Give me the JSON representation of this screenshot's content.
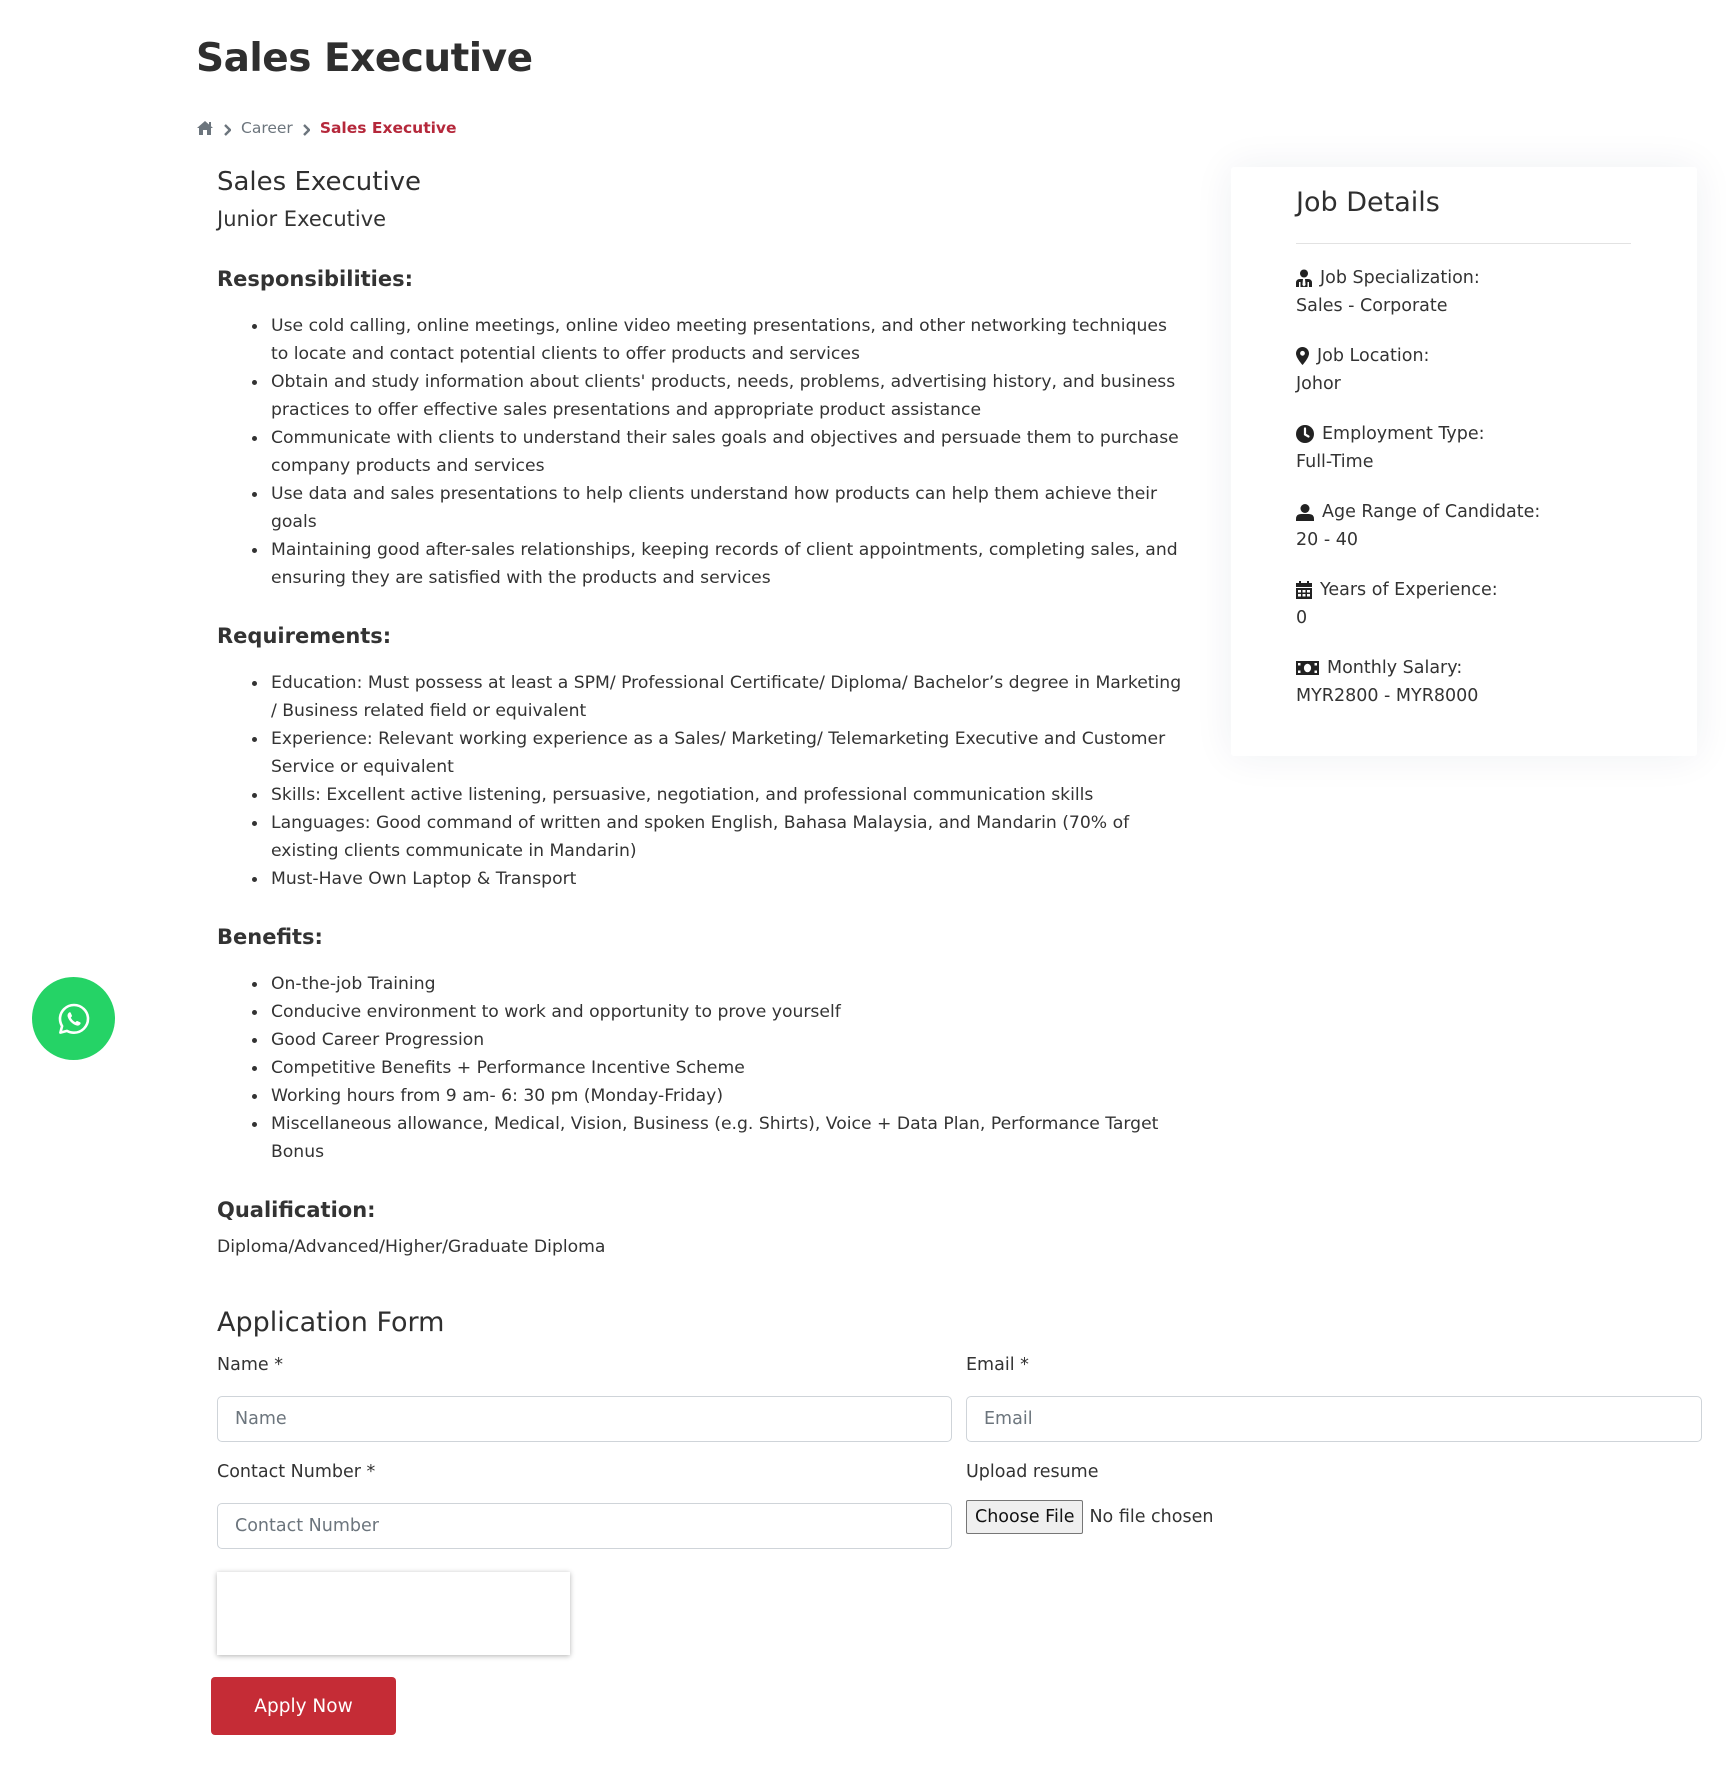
{
  "page": {
    "title": "Sales Executive"
  },
  "breadcrumb": {
    "home_icon": "home-icon",
    "separator_icon": "chevron-right-icon",
    "items": [
      "Career",
      "Sales Executive"
    ]
  },
  "job": {
    "title": "Sales Executive",
    "level": "Junior Executive",
    "responsibilities": {
      "heading": "Responsibilities:",
      "items": [
        "Use cold calling, online meetings, online video meeting presentations, and other networking techniques to locate and contact potential clients to offer products and services",
        "Obtain and study information about clients' products, needs, problems, advertising history, and business practices to offer effective sales presentations and appropriate product assistance",
        "Communicate with clients to understand their sales goals and objectives and persuade them to purchase company products and services",
        "Use data and sales presentations to help clients understand how products can help them achieve their goals",
        "Maintaining good after-sales relationships, keeping records of client appointments, completing sales, and ensuring they are satisfied with the products and services"
      ]
    },
    "requirements": {
      "heading": "Requirements:",
      "items": [
        "Education: Must possess at least a SPM/ Professional Certificate/ Diploma/ Bachelor’s degree in Marketing / Business related field or equivalent",
        "Experience: Relevant working experience as a Sales/ Marketing/ Telemarketing Executive and Customer Service or equivalent",
        "Skills: Excellent active listening, persuasive, negotiation, and professional communication skills",
        "Languages: Good command of written and spoken English, Bahasa Malaysia, and Mandarin (70% of existing clients communicate in Mandarin)",
        "Must-Have Own Laptop & Transport"
      ]
    },
    "benefits": {
      "heading": "Benefits:",
      "items": [
        "On-the-job Training",
        "Conducive environment to work and opportunity to prove yourself",
        "Good Career Progression",
        "Competitive Benefits + Performance Incentive Scheme",
        "Working hours from 9 am- 6: 30 pm (Monday-Friday)",
        "Miscellaneous allowance, Medical, Vision, Business (e.g. Shirts), Voice + Data Plan, Performance Target Bonus"
      ]
    },
    "qualification": {
      "heading": "Qualification:",
      "value": "Diploma/Advanced/Higher/Graduate Diploma"
    }
  },
  "job_details": {
    "title": "Job Details",
    "items": [
      {
        "icon": "user-tie-icon",
        "label": "Job Specialization:",
        "value": "Sales - Corporate"
      },
      {
        "icon": "map-marker-icon",
        "label": "Job Location:",
        "value": "Johor"
      },
      {
        "icon": "clock-icon",
        "label": "Employment Type:",
        "value": "Full-Time"
      },
      {
        "icon": "user-icon",
        "label": "Age Range of Candidate:",
        "value": "20 - 40"
      },
      {
        "icon": "calendar-icon",
        "label": "Years of Experience:",
        "value": "0"
      },
      {
        "icon": "money-bill-icon",
        "label": "Monthly Salary:",
        "value": "MYR2800 - MYR8000"
      }
    ]
  },
  "application_form": {
    "title": "Application Form",
    "name": {
      "label": "Name *",
      "placeholder": "Name",
      "value": ""
    },
    "email": {
      "label": "Email *",
      "placeholder": "Email",
      "value": ""
    },
    "contact": {
      "label": "Contact Number *",
      "placeholder": "Contact Number",
      "value": ""
    },
    "resume": {
      "label": "Upload resume",
      "button": "Choose File",
      "status": "No file chosen"
    },
    "submit_label": "Apply Now"
  },
  "floating": {
    "whatsapp_icon": "whatsapp-icon"
  },
  "colors": {
    "accent": "#c52c36",
    "breadcrumb_active": "#b5283b",
    "whatsapp": "#25d366"
  }
}
